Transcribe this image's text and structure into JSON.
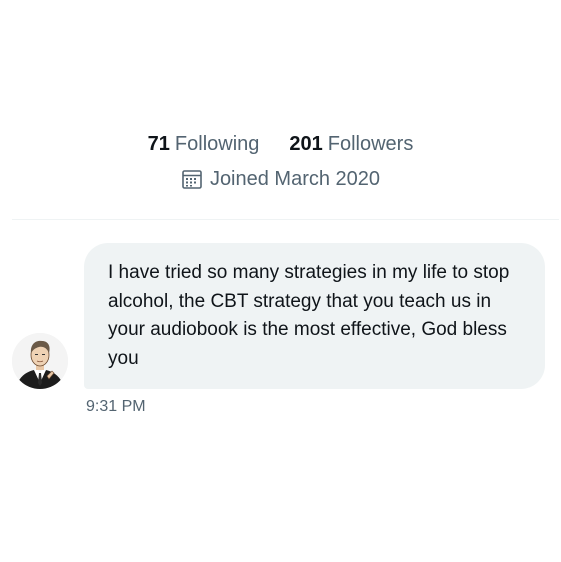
{
  "profile": {
    "following_count": "71",
    "following_label": "Following",
    "followers_count": "201",
    "followers_label": "Followers",
    "joined_text": "Joined March 2020",
    "joined_icon": "calendar-icon"
  },
  "message": {
    "text": "I have tried so many strategies in my life to stop alcohol, the CBT strategy that you teach us in your audiobook is the most effective, God bless you",
    "time": "9:31 PM"
  },
  "colors": {
    "text_primary": "#0f1419",
    "text_secondary": "#536471",
    "bubble_bg": "#eff3f4"
  }
}
